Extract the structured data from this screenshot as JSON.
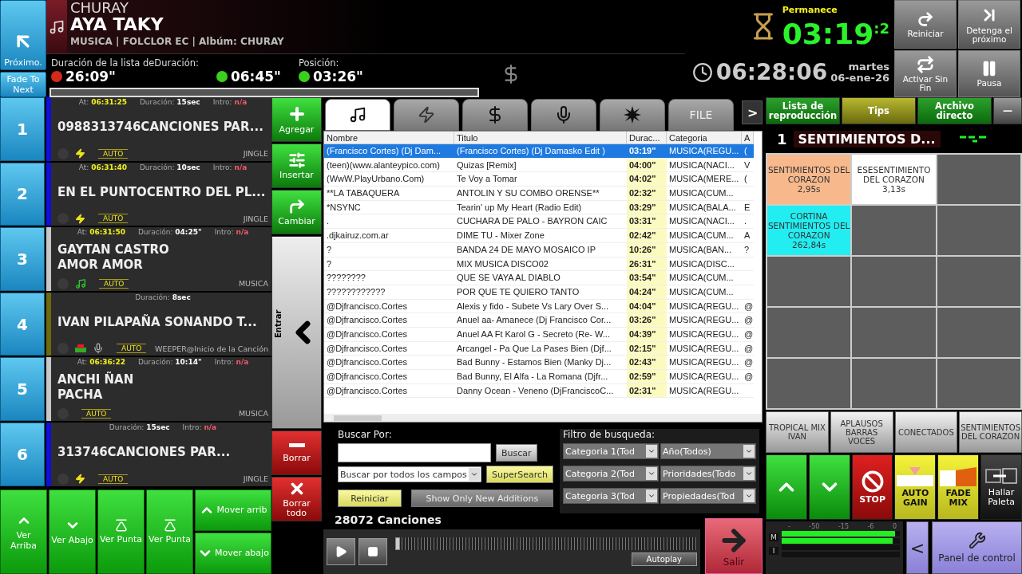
{
  "header": {
    "next_button": "Próximo.",
    "fade_button": "Fade To Next",
    "artist": "CHURAY",
    "title": "AYA TAKY",
    "meta": "MUSICA | FOLCLOR EC | Albúm: CHURAY",
    "timers": [
      {
        "label": "Duración de la lista deDuración:",
        "value": "26:09\"",
        "color": "#d42a1a"
      },
      {
        "value": "06:45\"",
        "color": "#3ad11c"
      },
      {
        "label": "Posición:",
        "value": "03:26\"",
        "color": "#3ad11c"
      }
    ],
    "remaining_label": "Permanece",
    "remaining": "03:19",
    "remaining_tenths": ":2",
    "clock": "06:28:06",
    "weekday": "martes",
    "date": "06-ene-26",
    "buttons": [
      {
        "kind": "restart",
        "label": "Reiniciar"
      },
      {
        "kind": "stopnext",
        "label": "Detenga el próximo"
      },
      {
        "kind": "loop",
        "label": "Activar Sin Fin"
      },
      {
        "kind": "pause",
        "label": "Pausa"
      }
    ]
  },
  "playlist": [
    {
      "number": "1",
      "color": "#1010d8",
      "fields": [
        {
          "kind": "at",
          "label": "At:",
          "value": "06:31:25"
        },
        {
          "kind": "duration",
          "label": "Duración:",
          "value": "15sec"
        },
        {
          "kind": "intro",
          "label": "Intro:",
          "value": "n/a"
        }
      ],
      "title": [
        "0988313746CANCIONES PAR..."
      ],
      "kind": "jingle",
      "auto": "AUTO",
      "category": "JINGLE"
    },
    {
      "number": "2",
      "color": "#1010d8",
      "fields": [
        {
          "kind": "at",
          "label": "At:",
          "value": "06:31:40"
        },
        {
          "kind": "duration",
          "label": "Duración:",
          "value": "10sec"
        },
        {
          "kind": "intro",
          "label": "Intro:",
          "value": "n/a"
        }
      ],
      "title": [
        "EN EL PUNTOCENTRO DEL PL..."
      ],
      "kind": "jingle",
      "auto": "AUTO",
      "category": "JINGLE"
    },
    {
      "number": "3",
      "color": "#c8c8c8",
      "fields": [
        {
          "kind": "at",
          "label": "At:",
          "value": "06:31:50"
        },
        {
          "kind": "duration",
          "label": "Duración:",
          "value": "04:25\""
        },
        {
          "kind": "intro",
          "label": "Intro:",
          "value": "n/a"
        }
      ],
      "title": [
        "GAYTAN CASTRO",
        "AMOR AMOR"
      ],
      "kind": "music",
      "auto": "AUTO",
      "category": "MUSICA"
    },
    {
      "number": "4",
      "color": "#6e6a10",
      "fields": [
        {
          "kind": "duration",
          "label": "Duración:",
          "value": "8sec"
        }
      ],
      "title": [
        "IVAN PILAPAÑA SONANDO T..."
      ],
      "kind": "voice",
      "auto": "AUTO",
      "category": "WEEPER@Inicio de la Canción"
    },
    {
      "number": "5",
      "color": "#c8c8c8",
      "fields": [
        {
          "kind": "at",
          "label": "At:",
          "value": "06:36:22"
        },
        {
          "kind": "duration",
          "label": "Duración:",
          "value": "10:14\""
        },
        {
          "kind": "intro",
          "label": "Intro:",
          "value": "n/a"
        }
      ],
      "title": [
        "ANCHI ÑAN",
        "PACHA"
      ],
      "kind": "hidden",
      "auto": "AUTO",
      "category": "MUSICA"
    },
    {
      "number": "6",
      "color": "#1010d8",
      "fields": [
        {
          "kind": "duration",
          "label": "Duración:",
          "value": "15sec"
        },
        {
          "kind": "intro",
          "label": "Intro:",
          "value": "n/a"
        }
      ],
      "title": [
        "313746CANCIONES PAR..."
      ],
      "kind": "jingle",
      "auto": "AUTO",
      "category": "JINGLE"
    }
  ],
  "side_buttons": [
    {
      "kind": "add",
      "label": "Agregar"
    },
    {
      "kind": "insert",
      "label": "Insertar"
    },
    {
      "kind": "change",
      "label": "Cambiar"
    },
    {
      "kind": "enter",
      "label": "Entrar"
    },
    {
      "kind": "delete",
      "label": "Borrar"
    },
    {
      "kind": "clear",
      "label": "Borrar todo"
    }
  ],
  "nav_buttons": [
    {
      "kind": "up",
      "label": "Ver Arriba"
    },
    {
      "kind": "down",
      "label": "Ver Abajo"
    },
    {
      "kind": "top",
      "label": "Ver Punta"
    },
    {
      "kind": "top2",
      "label": "Ver Punta"
    },
    {
      "kind": "moveup",
      "label": "Mover arrib"
    },
    {
      "kind": "movedown",
      "label": "Mover abajo"
    }
  ],
  "library": {
    "tabs": [
      {
        "kind": "music",
        "selected": true
      },
      {
        "kind": "jingle",
        "selected": false
      },
      {
        "kind": "money",
        "selected": false
      },
      {
        "kind": "mic",
        "selected": false
      },
      {
        "kind": "effect",
        "selected": false
      },
      {
        "kind": "text",
        "label": "FILE",
        "selected": false
      }
    ],
    "more_button": ">",
    "columns": [
      "Nombre",
      "Titulo",
      "Durac...",
      "Categoria",
      "A"
    ],
    "rows": [
      {
        "selected": true,
        "cells": [
          "(Francisco Cortes) (Dj Dam...",
          "(Francisco Cortes) (Dj Damasko Edit )",
          "03:19\"",
          "MUSICA(REGU...",
          "("
        ]
      },
      {
        "selected": false,
        "cells": [
          "(teen)(www.alanteypico.com)",
          "Quizas [Remix]",
          "04:00\"",
          "MUSICA(NACI...",
          "V"
        ]
      },
      {
        "selected": false,
        "cells": [
          "(WwW.PlayUrbano.Com)",
          "Te Voy a Tomar",
          "04:02\"",
          "MUSICA(MERE...",
          "("
        ]
      },
      {
        "selected": false,
        "cells": [
          "**LA TABAQUERA",
          "ANTOLIN Y SU COMBO ORENSE**",
          "02:32\"",
          "MUSICA(CUM..."
        ]
      },
      {
        "selected": false,
        "cells": [
          "*NSYNC",
          "Tearin' up My Heart (Radio Edit)",
          "03:29\"",
          "MUSICA(BALA...",
          "E"
        ]
      },
      {
        "selected": false,
        "cells": [
          ".",
          "CUCHARA DE PALO - BAYRON CAIC",
          "03:31\"",
          "MUSICA(NACI...",
          "."
        ]
      },
      {
        "selected": false,
        "cells": [
          ".djkairuz.com.ar",
          "DIME TU - Mixer Zone",
          "02:42\"",
          "MUSICA(CUM...",
          "A"
        ]
      },
      {
        "selected": false,
        "cells": [
          "?",
          "BANDA 24 DE MAYO MOSAICO IP",
          "10:26\"",
          "MUSICA(BAN...",
          "?"
        ]
      },
      {
        "selected": false,
        "cells": [
          "?",
          "MIX MUSICA DISCO02",
          "26:31\"",
          "MUSICA(DISC..."
        ]
      },
      {
        "selected": false,
        "cells": [
          "????????",
          "QUE SE VAYA AL DIABLO",
          "03:54\"",
          "MUSICA(CUM..."
        ]
      },
      {
        "selected": false,
        "cells": [
          "????????????",
          "POR QUE TE QUIERO TANTO",
          "04:24\"",
          "MUSICA(CUM..."
        ]
      },
      {
        "selected": false,
        "cells": [
          "@Djfrancisco.Cortes",
          "Alexis y fido - Subete Vs Lary Over S...",
          "04:04\"",
          "MUSICA(REGU...",
          "@"
        ]
      },
      {
        "selected": false,
        "cells": [
          "@Djfrancisco.Cortes",
          "Anuel aa- Amanece (Dj Francisco Cor...",
          "03:26\"",
          "MUSICA(REGU...",
          "@"
        ]
      },
      {
        "selected": false,
        "cells": [
          "@Djfrancisco.Cortes",
          "Anuel AA Ft Karol G - Secreto (Re- W...",
          "04:39\"",
          "MUSICA(REGU...",
          "@"
        ]
      },
      {
        "selected": false,
        "cells": [
          "@Djfrancisco.Cortes",
          "Arcangel - Pa Que La Pases Bien (Djf...",
          "02:15\"",
          "MUSICA(REGU...",
          "@"
        ]
      },
      {
        "selected": false,
        "cells": [
          "@Djfrancisco.Cortes",
          "Bad Bunny - Estamos Bien (Manky Dj...",
          "02:43\"",
          "MUSICA(REGU...",
          "@"
        ]
      },
      {
        "selected": false,
        "cells": [
          "@Djfrancisco.Cortes",
          "Bad Bunny, El Alfa - La Romana (Djfr...",
          "02:59\"",
          "MUSICA(REGU...",
          "@"
        ]
      },
      {
        "selected": false,
        "cells": [
          "@Djfrancisco.Cortes",
          "Danny Ocean - Veneno (DjFranciscoC...",
          "02:31\"",
          "MUSICA(REGU..."
        ]
      }
    ]
  },
  "search": {
    "label": "Buscar Por:",
    "button": "Buscar",
    "scope": "Buscar por todos los campos",
    "super": "SuperSearch",
    "reset": "Reiniciar",
    "new_only": "Show Only New Additions",
    "filter_label": "Filtro de busqueda:",
    "filters": [
      "Categoria 1(Tod",
      "Año(Todos)",
      "Categoria 2(Tod",
      "Prioridades(Todo",
      "Categoria 3(Tod",
      "Propiedades(Tod"
    ]
  },
  "player": {
    "count": "28072 Canciones",
    "level": 0.0,
    "autoplay": "Autoplay",
    "exit": "Salir"
  },
  "panel": {
    "tabs": [
      {
        "label": "Lista de reproducción",
        "selected": false
      },
      {
        "label": "Tips",
        "selected": true
      },
      {
        "label": "Archivo directo",
        "selected": false
      }
    ],
    "minimize": "—",
    "page_number": "1",
    "page_title": "SENTIMIENTOS D...",
    "pads": [
      {
        "kind": "sound",
        "label": "SENTIMIENTOS DEL CORAZON",
        "duration": "2,95s",
        "color": "#f7b98c"
      },
      {
        "kind": "sound",
        "label": "ESESENTIMIENTO DEL CORAZON",
        "duration": "3,13s",
        "color": "#ffffff"
      },
      {
        "kind": "empty"
      },
      {
        "kind": "sound",
        "label": "CORTINA SENTIMIENTOS DEL CORAZON",
        "duration": "262,84s",
        "color": "#22eef2"
      },
      {
        "kind": "empty"
      },
      {
        "kind": "empty"
      },
      {
        "kind": "empty"
      },
      {
        "kind": "empty"
      },
      {
        "kind": "empty"
      },
      {
        "kind": "empty"
      },
      {
        "kind": "empty"
      },
      {
        "kind": "empty"
      },
      {
        "kind": "empty"
      },
      {
        "kind": "empty"
      },
      {
        "kind": "empty"
      }
    ],
    "banks": [
      "TROPICAL MIX IVAN",
      "APLAUSOS BARRAS VOCES",
      "CONECTADOS",
      "SENTIMIENTOS DEL CORAZON"
    ],
    "controls": [
      {
        "kind": "up"
      },
      {
        "kind": "down"
      },
      {
        "kind": "stop",
        "label": "STOP"
      },
      {
        "kind": "autogain",
        "label": "AUTO GAIN"
      },
      {
        "kind": "fademix",
        "label": "FADE MIX"
      },
      {
        "kind": "palette",
        "label": "Hallar Paleta"
      }
    ],
    "meter": {
      "scale": [
        "-",
        "-50",
        "-15",
        "-6",
        "0"
      ],
      "channels": [
        {
          "label": "M",
          "bars": [
            {
              "level": 0.96
            },
            {
              "level": 0.94
            }
          ]
        },
        {
          "label": "I"
        }
      ]
    },
    "back": "<",
    "control_panel": "Panel de control"
  }
}
